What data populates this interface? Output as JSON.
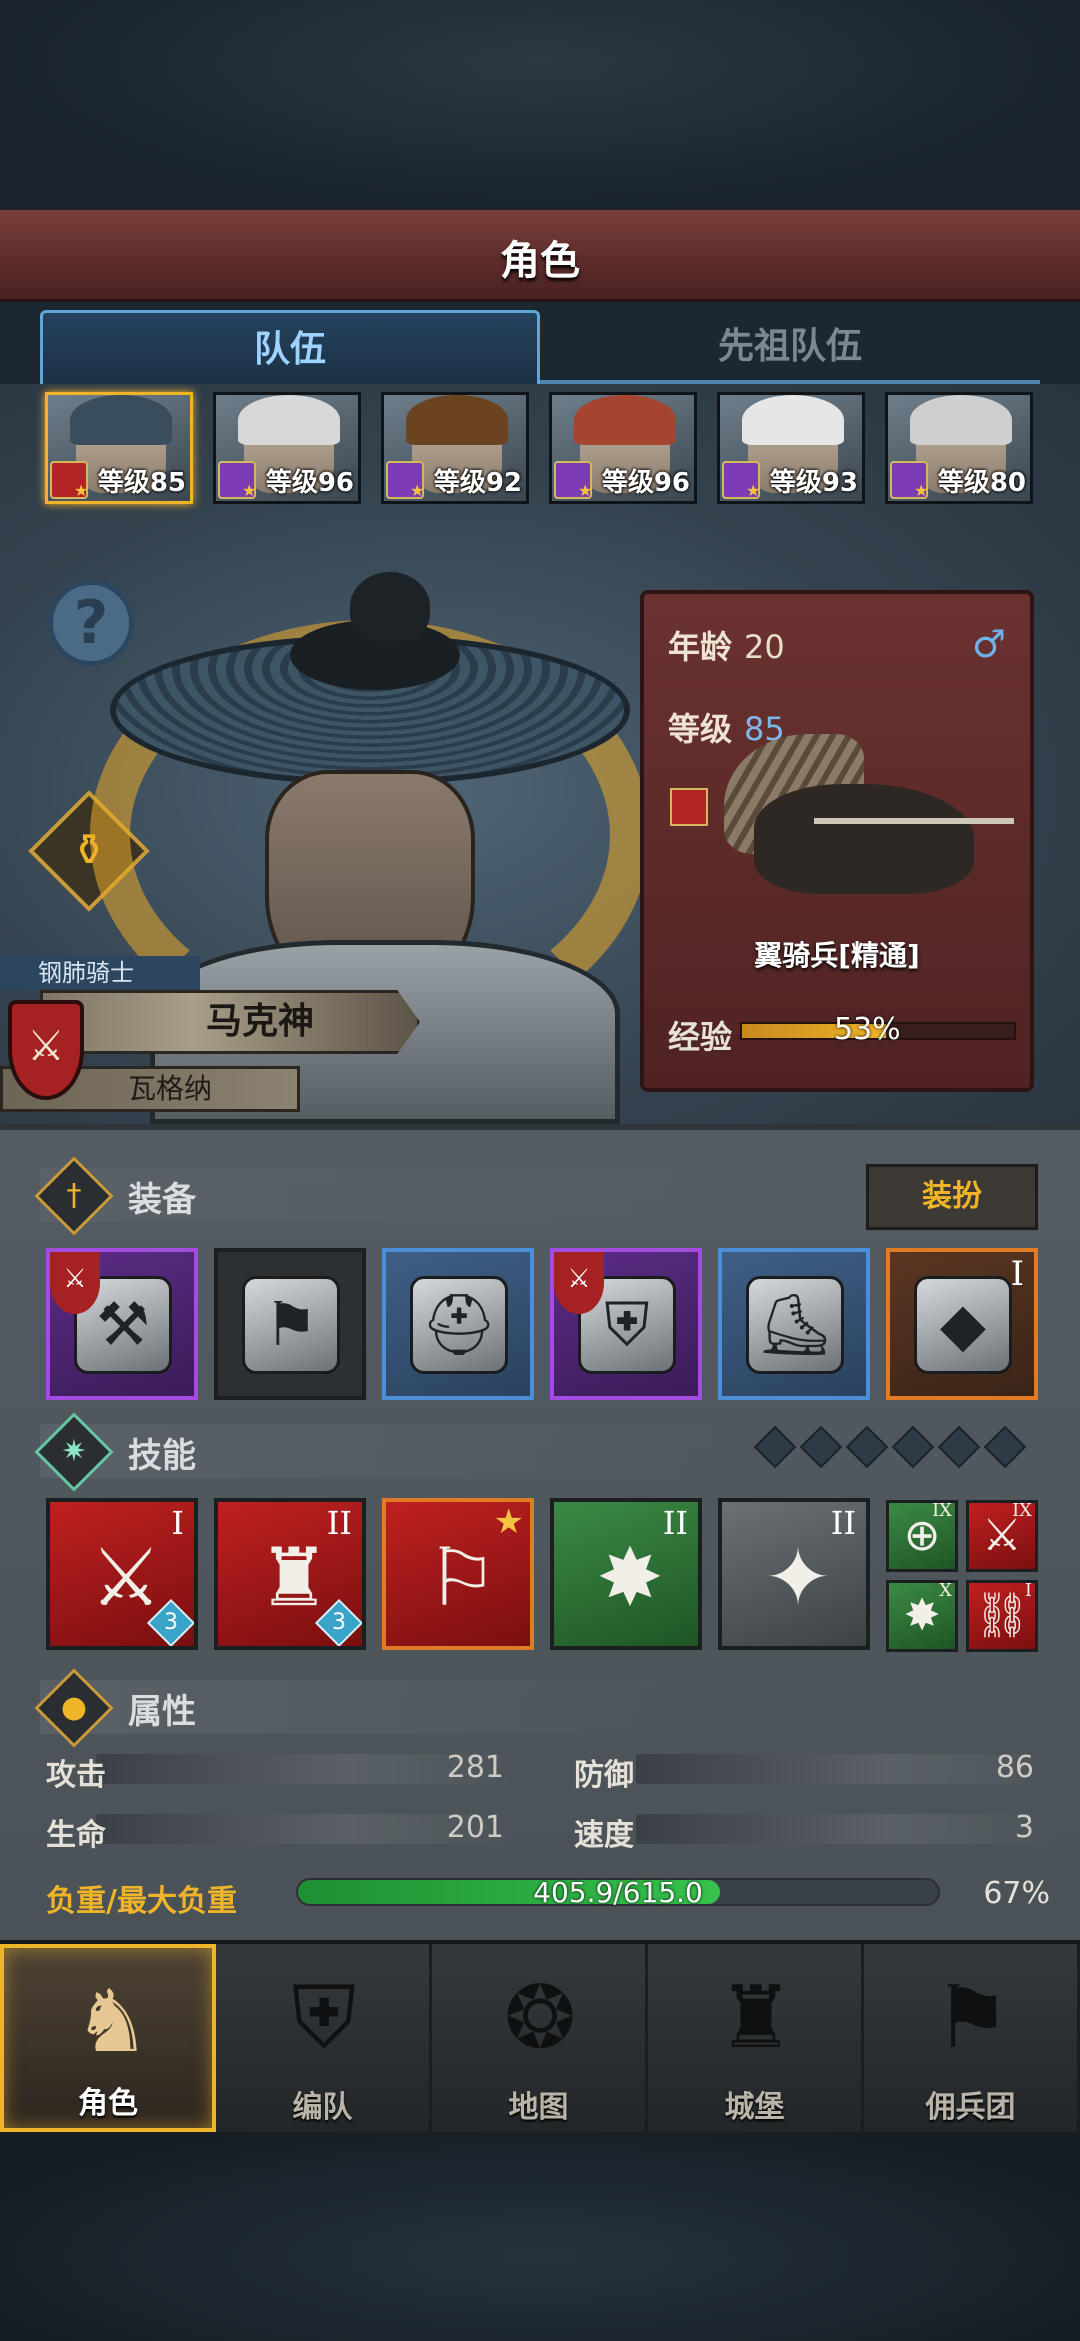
{
  "header": {
    "title": "角色"
  },
  "tabs": [
    {
      "label": "队伍",
      "active": true
    },
    {
      "label": "先祖队伍",
      "active": false
    }
  ],
  "party": [
    {
      "level_text": "等级85",
      "class_color": "red",
      "selected": true,
      "hair": "#3a4d5c"
    },
    {
      "level_text": "等级96",
      "class_color": "purple",
      "selected": false,
      "hair": "#d8d8d8"
    },
    {
      "level_text": "等级92",
      "class_color": "purple",
      "selected": false,
      "hair": "#6a4420"
    },
    {
      "level_text": "等级96",
      "class_color": "purple",
      "selected": false,
      "hair": "#a3452f"
    },
    {
      "level_text": "等级93",
      "class_color": "purple",
      "selected": false,
      "hair": "#e6e6e6"
    },
    {
      "level_text": "等级80",
      "class_color": "purple",
      "selected": false,
      "hair": "#cfcfcf"
    }
  ],
  "hero": {
    "class_title": "钢肺骑士",
    "name": "马克神",
    "origin": "瓦格纳"
  },
  "info": {
    "age_label": "年龄",
    "age": "20",
    "gender_icon": "♂",
    "level_label": "等级",
    "level": "85",
    "mount_name": "翼骑兵[精通]",
    "xp_label": "经验",
    "xp_percent_text": "53%",
    "xp_fraction": 0.53
  },
  "equipment": {
    "title": "装备",
    "outfit_label": "装扮",
    "slots": [
      {
        "rarity": "purple",
        "badge": true,
        "roman": "",
        "name": "hammer-axe-icon",
        "glyph": "⚒"
      },
      {
        "rarity": "none",
        "badge": false,
        "roman": "",
        "name": "banner-icon",
        "glyph": "⚑"
      },
      {
        "rarity": "blue",
        "badge": false,
        "roman": "",
        "name": "helmet-icon",
        "glyph": "⛑"
      },
      {
        "rarity": "purple",
        "badge": true,
        "roman": "",
        "name": "plate-armor-icon",
        "glyph": "⛨"
      },
      {
        "rarity": "blue",
        "badge": false,
        "roman": "",
        "name": "greaves-icon",
        "glyph": "⛸"
      },
      {
        "rarity": "orange",
        "badge": false,
        "roman": "I",
        "name": "emerald-gem-icon",
        "glyph": "◆"
      }
    ]
  },
  "skills": {
    "title": "技能",
    "items": [
      {
        "color": "red",
        "roman": "I",
        "count": "3",
        "star": false,
        "name": "sword-break-skill-icon",
        "glyph": "⚔"
      },
      {
        "color": "red",
        "roman": "II",
        "count": "3",
        "star": false,
        "name": "summon-skill-icon",
        "glyph": "♜"
      },
      {
        "color": "red",
        "roman": "",
        "count": "",
        "star": true,
        "name": "wolf-banner-skill-icon",
        "glyph": "⚐"
      },
      {
        "color": "green",
        "roman": "II",
        "count": "",
        "star": false,
        "name": "crystal-burst-skill-icon",
        "glyph": "✸"
      },
      {
        "color": "grey",
        "roman": "II",
        "count": "",
        "star": false,
        "name": "crystal-arm-skill-icon",
        "glyph": "✦"
      }
    ],
    "passives": [
      {
        "color": "green",
        "roman": "IX",
        "name": "target-passive-icon",
        "glyph": "⊕"
      },
      {
        "color": "red",
        "roman": "IX",
        "name": "sword-passive-icon",
        "glyph": "⚔"
      },
      {
        "color": "green",
        "roman": "X",
        "name": "burst-passive-icon",
        "glyph": "✸"
      },
      {
        "color": "red",
        "roman": "I",
        "name": "strength-passive-icon",
        "glyph": "⛓"
      }
    ]
  },
  "attributes": {
    "title": "属性",
    "attack_label": "攻击",
    "attack": "281",
    "defense_label": "防御",
    "defense": "86",
    "hp_label": "生命",
    "hp": "201",
    "speed_label": "速度",
    "speed": "3",
    "load_label": "负重/最大负重",
    "load_text": "405.9/615.0",
    "load_percent": "67%",
    "load_fraction": 0.66
  },
  "nav": [
    {
      "label": "角色",
      "active": true,
      "name": "nav-character",
      "icon": "knight-icon",
      "glyph": "♞"
    },
    {
      "label": "编队",
      "active": false,
      "name": "nav-formation",
      "icon": "helmet-formation-icon",
      "glyph": "⛨"
    },
    {
      "label": "地图",
      "active": false,
      "name": "nav-map",
      "icon": "compass-map-icon",
      "glyph": "❂"
    },
    {
      "label": "城堡",
      "active": false,
      "name": "nav-castle",
      "icon": "castle-icon",
      "glyph": "♜"
    },
    {
      "label": "佣兵团",
      "active": false,
      "name": "nav-mercenary",
      "icon": "mercenary-banner-icon",
      "glyph": "⚑"
    }
  ]
}
